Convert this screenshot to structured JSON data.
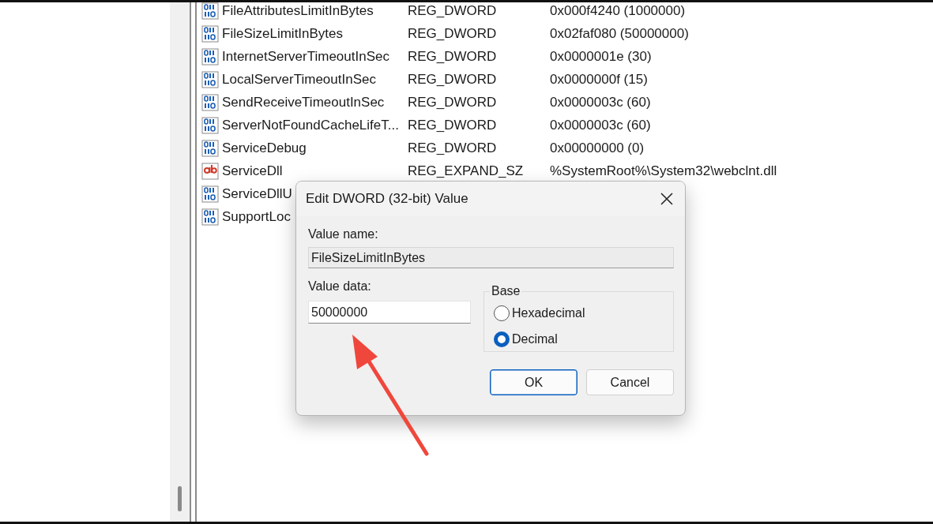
{
  "values_list": {
    "rows": [
      {
        "kind": "dword",
        "name": "FileAttributesLimitInBytes",
        "type": "REG_DWORD",
        "data": "0x000f4240 (1000000)"
      },
      {
        "kind": "dword",
        "name": "FileSizeLimitInBytes",
        "type": "REG_DWORD",
        "data": "0x02faf080 (50000000)"
      },
      {
        "kind": "dword",
        "name": "InternetServerTimeoutInSec",
        "type": "REG_DWORD",
        "data": "0x0000001e (30)"
      },
      {
        "kind": "dword",
        "name": "LocalServerTimeoutInSec",
        "type": "REG_DWORD",
        "data": "0x0000000f (15)"
      },
      {
        "kind": "dword",
        "name": "SendReceiveTimeoutInSec",
        "type": "REG_DWORD",
        "data": "0x0000003c (60)"
      },
      {
        "kind": "dword",
        "name": "ServerNotFoundCacheLifeT...",
        "type": "REG_DWORD",
        "data": "0x0000003c (60)"
      },
      {
        "kind": "dword",
        "name": "ServiceDebug",
        "type": "REG_DWORD",
        "data": "0x00000000 (0)"
      },
      {
        "kind": "string",
        "name": "ServiceDll",
        "type": "REG_EXPAND_SZ",
        "data": "%SystemRoot%\\System32\\webclnt.dll"
      },
      {
        "kind": "dword",
        "name": "ServiceDllU"
      },
      {
        "kind": "dword",
        "name": "SupportLoc"
      }
    ]
  },
  "dialog": {
    "title": "Edit DWORD (32-bit) Value",
    "value_name_label": "Value name:",
    "value_name": "FileSizeLimitInBytes",
    "value_data_label": "Value data:",
    "value_data": "50000000",
    "base_label": "Base",
    "base_options": [
      {
        "label": "Hexadecimal",
        "selected": false
      },
      {
        "label": "Decimal",
        "selected": true
      }
    ],
    "buttons": [
      {
        "label": "OK",
        "default": true
      },
      {
        "label": "Cancel",
        "default": false
      }
    ]
  }
}
